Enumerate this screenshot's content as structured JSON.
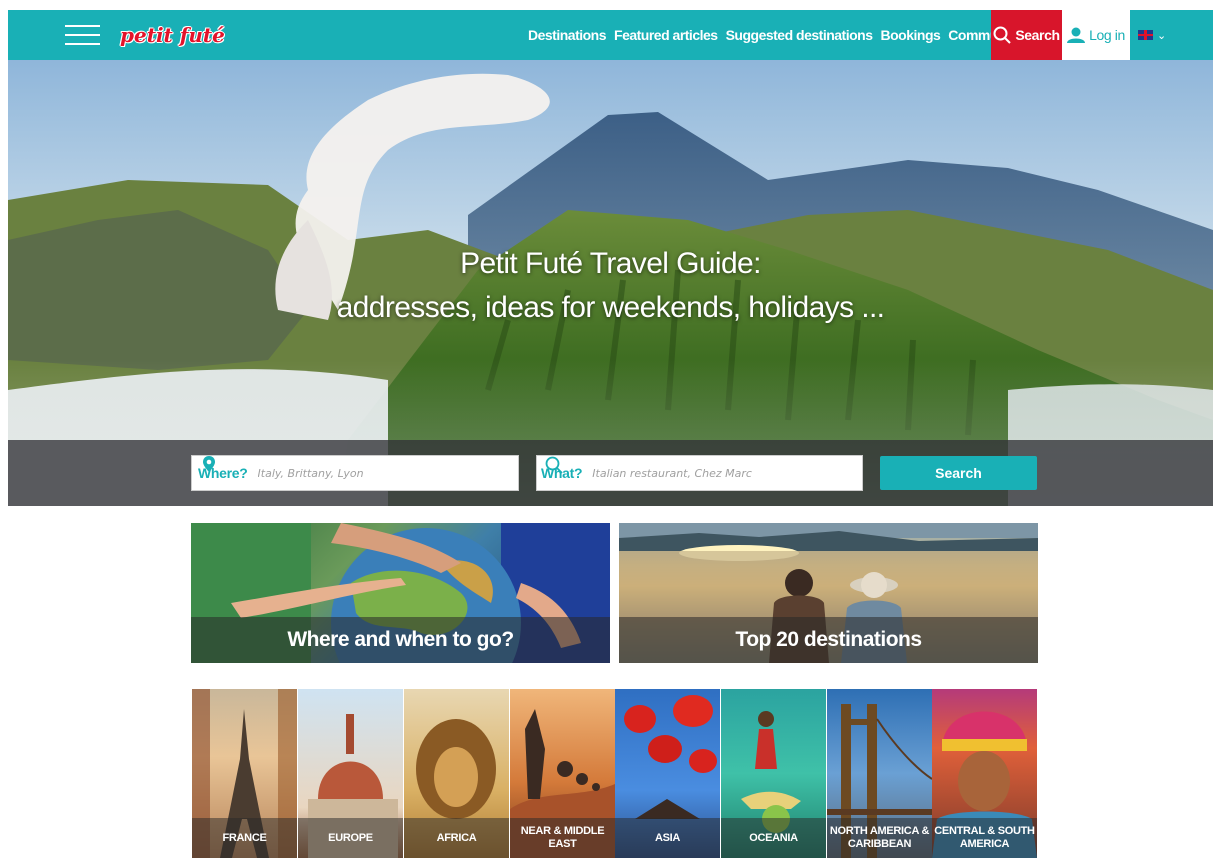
{
  "header": {
    "logo_text": "petit futé",
    "nav": [
      "Destinations",
      "Featured articles",
      "Suggested destinations",
      "Bookings",
      "Community"
    ],
    "search_label": "Search",
    "login_label": "Log in",
    "language": "EN",
    "colors": {
      "brand": "#19b0b6",
      "search": "#d8152b"
    }
  },
  "hero": {
    "title_line1": "Petit Futé Travel Guide:",
    "title_line2": "addresses, ideas for weekends, holidays ..."
  },
  "search": {
    "where_label": "Where?",
    "where_placeholder": "Italy, Brittany, Lyon",
    "what_label": "What?",
    "what_placeholder": "Italian restaurant, Chez Marc",
    "button": "Search"
  },
  "promos": [
    {
      "caption": "Where and when to go?"
    },
    {
      "caption": "Top 20 destinations"
    }
  ],
  "destinations": [
    {
      "label": "FRANCE"
    },
    {
      "label": "EUROPE"
    },
    {
      "label": "AFRICA"
    },
    {
      "label": "NEAR & MIDDLE EAST"
    },
    {
      "label": "ASIA"
    },
    {
      "label": "OCEANIA"
    },
    {
      "label": "NORTH AMERICA & CARIBBEAN"
    },
    {
      "label": "CENTRAL & SOUTH AMERICA"
    }
  ]
}
